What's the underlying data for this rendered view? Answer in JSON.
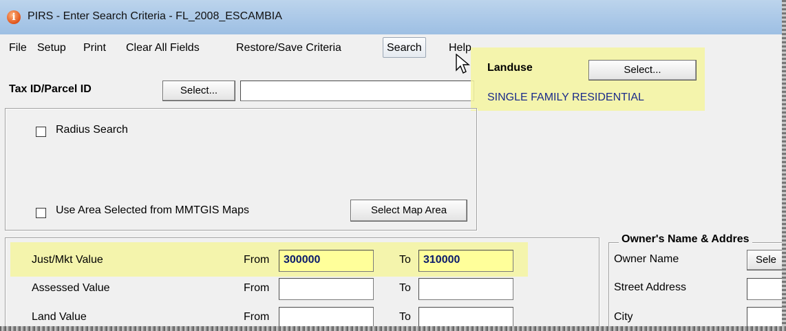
{
  "window": {
    "title": "PIRS - Enter Search Criteria - FL_2008_ESCAMBIA",
    "icon": "info-icon"
  },
  "menu": [
    "File",
    "Setup",
    "Print",
    "Clear All Fields",
    "Restore/Save Criteria",
    "Search",
    "Help"
  ],
  "taxid": {
    "label": "Tax ID/Parcel ID",
    "select_label": "Select...",
    "value": ""
  },
  "landuse": {
    "label": "Landuse",
    "select_label": "Select...",
    "value": "SINGLE FAMILY RESIDENTIAL"
  },
  "radius": {
    "label": "Radius Search",
    "checked": false
  },
  "area": {
    "label": "Use Area Selected from MMTGIS Maps",
    "checked": false,
    "button_label": "Select Map Area"
  },
  "values": {
    "from_label": "From",
    "to_label": "To",
    "rows": [
      {
        "label": "Just/Mkt Value",
        "from": "300000",
        "to": "310000"
      },
      {
        "label": "Assessed Value",
        "from": "",
        "to": ""
      },
      {
        "label": "Land Value",
        "from": "",
        "to": ""
      }
    ]
  },
  "owner": {
    "title": "Owner's Name & Addres",
    "name_label": "Owner Name",
    "select_label": "Sele",
    "street_label": "Street Address",
    "city_label": "City"
  },
  "colors": {
    "highlight": "#f5f5a0",
    "value_text": "#0a1a6a",
    "landuse_text": "#1a2a8a"
  }
}
